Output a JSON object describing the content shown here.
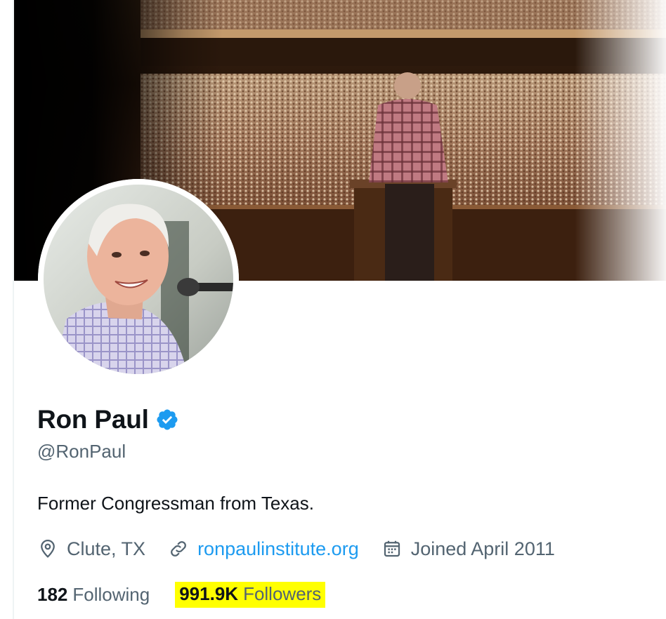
{
  "profile": {
    "display_name": "Ron Paul",
    "verified_icon": "verified-badge-icon",
    "handle": "@RonPaul",
    "bio": "Former Congressman from Texas."
  },
  "meta": {
    "location_icon": "location-pin-icon",
    "location": "Clute, TX",
    "link_icon": "link-icon",
    "website": "ronpaulinstitute.org",
    "calendar_icon": "calendar-icon",
    "joined": "Joined April 2011"
  },
  "stats": {
    "following_count": "182",
    "following_label": "Following",
    "followers_count": "991.9K",
    "followers_label": "Followers",
    "followers_highlight_color": "#ffff00"
  },
  "colors": {
    "link": "#1d9bf0",
    "verified": "#1d9bf0",
    "secondary_text": "#536471",
    "primary_text": "#0f1419"
  }
}
